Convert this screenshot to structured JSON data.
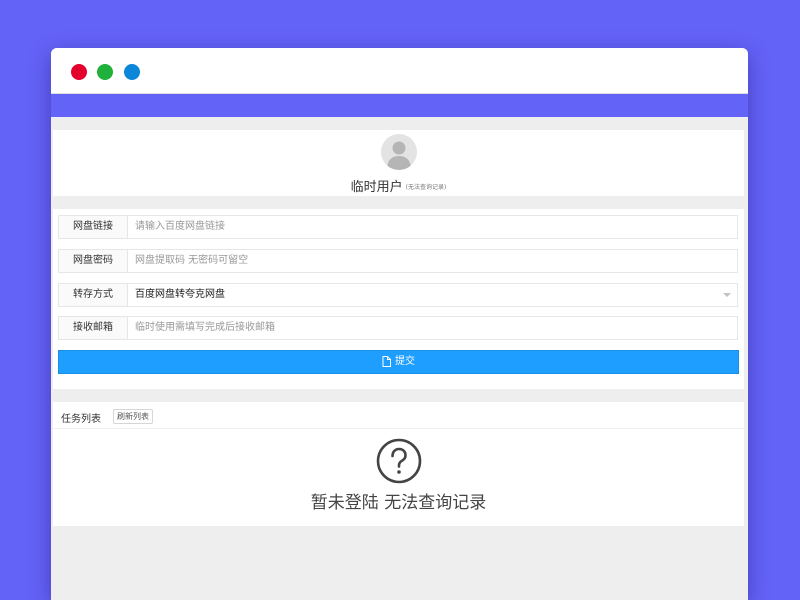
{
  "user": {
    "name": "临时用户",
    "note": "(无法查询记录)"
  },
  "form": {
    "rows": [
      {
        "label": "网盘链接",
        "placeholder": "请输入百度网盘链接"
      },
      {
        "label": "网盘密码",
        "placeholder": "网盘提取码 无密码可留空"
      },
      {
        "label": "转存方式",
        "value": "百度网盘转夸克网盘"
      },
      {
        "label": "接收邮箱",
        "placeholder": "临时使用需填写完成后接收邮箱"
      }
    ],
    "submit_label": "提交"
  },
  "tasks": {
    "title": "任务列表",
    "refresh_label": "刷新列表",
    "empty_message": "暂未登陆 无法查询记录"
  },
  "colors": {
    "background": "#6463f7",
    "navbar": "#6463f7",
    "submit_button": "#1e9fff",
    "dot_close": "#e3002d",
    "dot_minimize": "#1fb13b",
    "dot_maximize": "#0c86d8"
  },
  "icons": {
    "avatar": "user-avatar-icon",
    "submit": "document-icon",
    "empty": "question-circle-icon",
    "select": "chevron-down-icon"
  }
}
